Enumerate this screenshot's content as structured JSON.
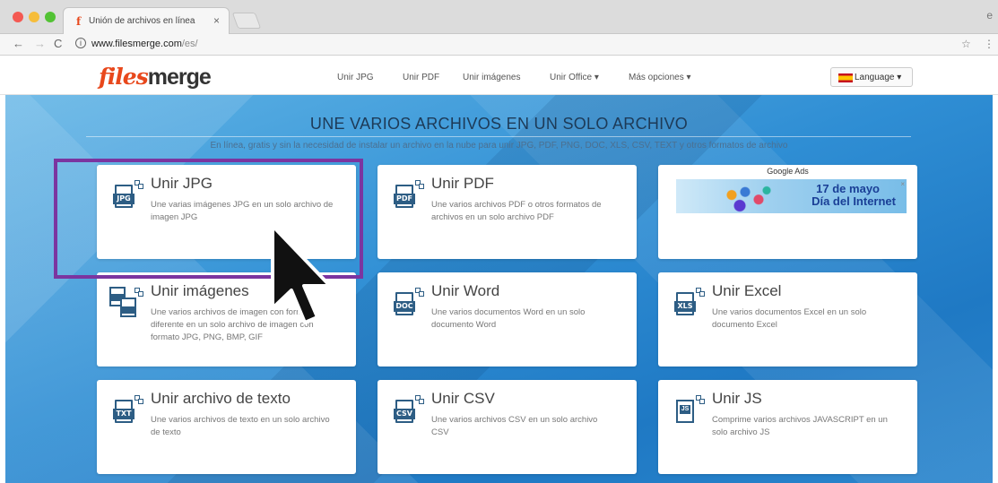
{
  "browser": {
    "tab_title": "Unión de archivos en línea",
    "tab_close": "×",
    "url_host": "www.filesmerge.com",
    "url_path": "/es/",
    "back": "←",
    "forward": "→",
    "reload": "C",
    "info": "i",
    "star": "☆",
    "menu": "⋮",
    "profile": "e"
  },
  "header": {
    "logo_part1": "files",
    "logo_part2": "merge",
    "nav": [
      "Unir JPG",
      "Unir PDF",
      "Unir imágenes",
      "Unir Office ▾",
      "Más opciones ▾"
    ],
    "language": "Language ▾"
  },
  "hero": {
    "title": "UNE VARIOS ARCHIVOS EN UN SOLO ARCHIVO",
    "subtitle": "En línea, gratis y sin la necesidad de instalar un archivo en la nube para unir JPG, PDF, PNG, DOC, XLS, CSV, TEXT y otros formatos de archivo"
  },
  "cards": [
    {
      "title": "Unir JPG",
      "badge": "JPG",
      "desc": "Une varias imágenes JPG en un solo archivo de imagen JPG"
    },
    {
      "title": "Unir PDF",
      "badge": "PDF",
      "desc": "Une varios archivos PDF o otros formatos de archivos en un solo archivo PDF"
    },
    {
      "title": "Unir imágenes",
      "badge": "",
      "desc": "Une varios archivos de imagen con formato diferente en un solo archivo de imagen con formato JPG, PNG, BMP, GIF"
    },
    {
      "title": "Unir Word",
      "badge": "DOC",
      "desc": "Une varios documentos Word en un solo documento Word"
    },
    {
      "title": "Unir Excel",
      "badge": "XLS",
      "desc": "Une varios documentos Excel en un solo documento Excel"
    },
    {
      "title": "Unir archivo de texto",
      "badge": "TXT",
      "desc": "Une varios archivos de texto en un solo archivo de texto"
    },
    {
      "title": "Unir CSV",
      "badge": "CSV",
      "desc": "Une varios archivos CSV en un solo archivo CSV"
    },
    {
      "title": "Unir JS",
      "badge": "JS",
      "desc": "Comprime varios archivos JAVASCRIPT en un solo archivo JS"
    }
  ],
  "ad": {
    "label": "Google Ads",
    "line1": "17 de mayo",
    "line2": "Día del Internet",
    "close": "×"
  },
  "colors": {
    "accent": "#e8481c",
    "icon": "#2d5d84",
    "highlight": "#7b35a0"
  }
}
